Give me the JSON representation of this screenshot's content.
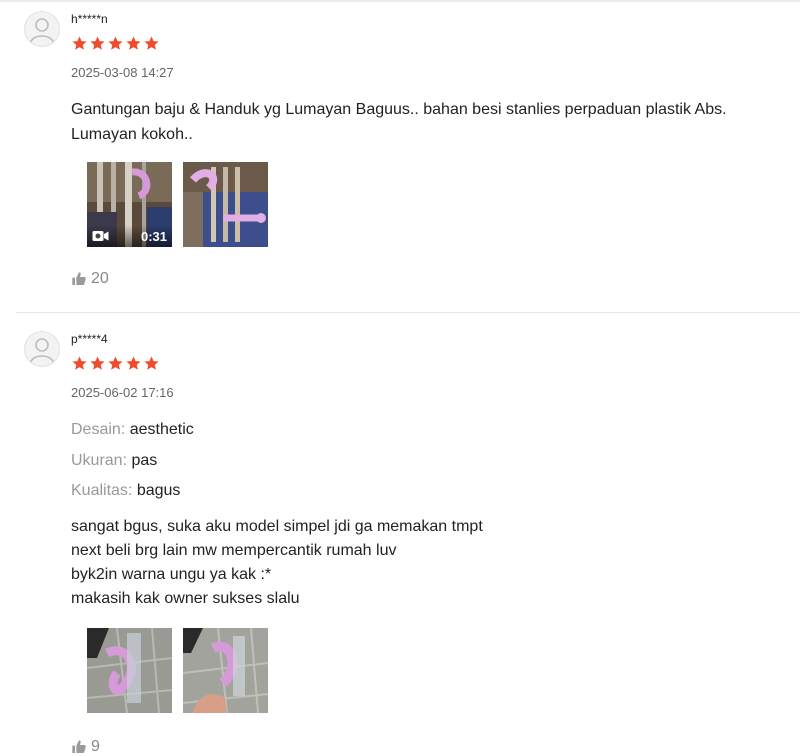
{
  "reviews": [
    {
      "username": "h*****n",
      "rating": 5,
      "date": "2025-03-08 14:27",
      "text": "Gantungan baju & Handuk yg Lumayan Baguus.. bahan besi stanlies perpaduan plastik Abs.\nLumayan kokoh..",
      "video_duration": "0:31",
      "likes": "20",
      "icons": {
        "avatar": "user-avatar-icon",
        "video": "video-camera-icon",
        "like": "thumbs-up-icon"
      }
    },
    {
      "username": "p*****4",
      "rating": 5,
      "date": "2025-06-02 17:16",
      "attributes": [
        {
          "label": "Desain:",
          "value": "aesthetic"
        },
        {
          "label": "Ukuran:",
          "value": "pas"
        },
        {
          "label": "Kualitas:",
          "value": "bagus"
        }
      ],
      "text": "sangat bgus, suka aku model simpel jdi ga memakan tmpt\nnext beli brg lain mw mempercantik rumah luv\nbyk2in warna ungu ya kak :*\nmakasih kak owner sukses slalu",
      "likes": "9"
    }
  ],
  "colors": {
    "star": "#ee4d2d",
    "muted": "#999999",
    "accent_purple": "#d69ad8"
  }
}
